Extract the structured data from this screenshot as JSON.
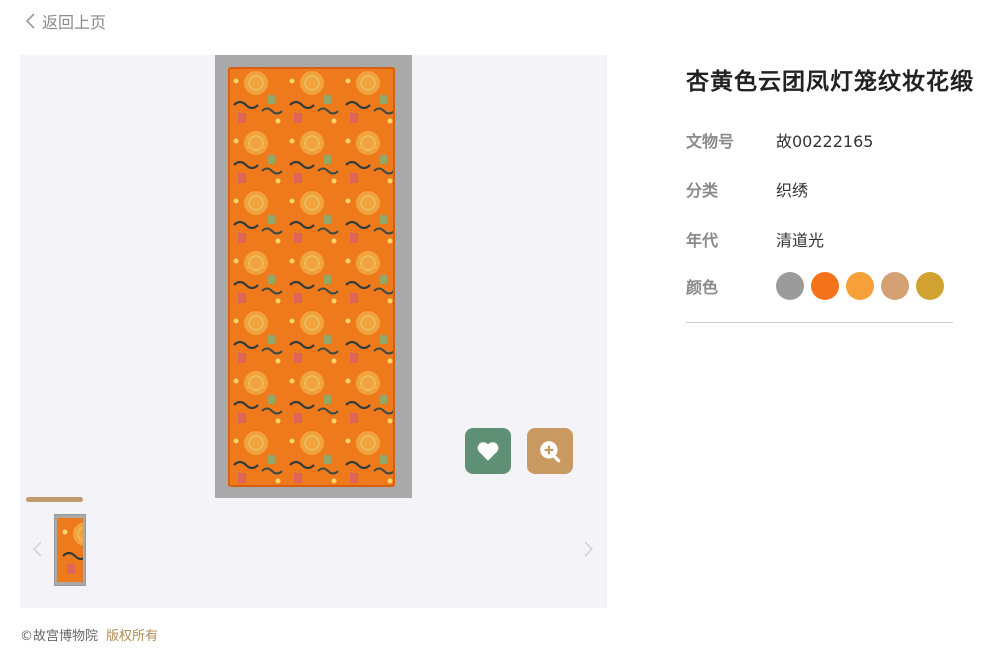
{
  "nav": {
    "back_label": "返回上页"
  },
  "artifact": {
    "title": "杏黄色云团凤灯笼纹妆花缎",
    "details": [
      {
        "label": "文物号",
        "value": "故00222165"
      },
      {
        "label": "分类",
        "value": "织绣"
      },
      {
        "label": "年代",
        "value": "清道光"
      }
    ],
    "color_label": "颜色",
    "colors": [
      "#9b9b9b",
      "#f47219",
      "#f6a03a",
      "#d4a174",
      "#d1a230"
    ]
  },
  "footer": {
    "copyright": "©故宫博物院",
    "rights": "版权所有"
  },
  "icons": {
    "back": "chevron-left-icon",
    "favorite": "heart-icon",
    "zoom": "zoom-in-icon",
    "prev": "chevron-left-icon",
    "next": "chevron-right-icon"
  },
  "theme": {
    "accent": "#c39a6b",
    "favorite_bg": "#5f8f75",
    "zoom_bg": "#c89a62"
  }
}
